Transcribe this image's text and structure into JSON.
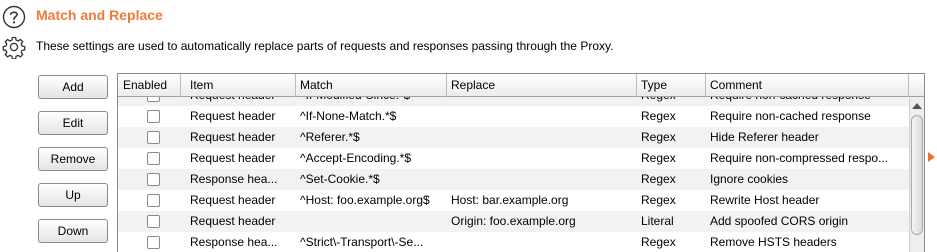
{
  "header": {
    "title": "Match and Replace",
    "description": "These settings are used to automatically replace parts of requests and responses passing through the Proxy."
  },
  "buttons": {
    "add": "Add",
    "edit": "Edit",
    "remove": "Remove",
    "up": "Up",
    "down": "Down"
  },
  "table": {
    "columns": [
      "Enabled",
      "Item",
      "Match",
      "Replace",
      "Type",
      "Comment"
    ],
    "rows": [
      {
        "enabled": false,
        "item": "Request header",
        "match": "^If-Modified-Since.*$",
        "replace": "",
        "type": "Regex",
        "comment": "Require non-cached response"
      },
      {
        "enabled": false,
        "item": "Request header",
        "match": "^If-None-Match.*$",
        "replace": "",
        "type": "Regex",
        "comment": "Require non-cached response"
      },
      {
        "enabled": false,
        "item": "Request header",
        "match": "^Referer.*$",
        "replace": "",
        "type": "Regex",
        "comment": "Hide Referer header"
      },
      {
        "enabled": false,
        "item": "Request header",
        "match": "^Accept-Encoding.*$",
        "replace": "",
        "type": "Regex",
        "comment": "Require non-compressed respo..."
      },
      {
        "enabled": false,
        "item": "Response hea...",
        "match": "^Set-Cookie.*$",
        "replace": "",
        "type": "Regex",
        "comment": "Ignore cookies"
      },
      {
        "enabled": false,
        "item": "Request header",
        "match": "^Host: foo.example.org$",
        "replace": "Host: bar.example.org",
        "type": "Regex",
        "comment": "Rewrite Host header"
      },
      {
        "enabled": false,
        "item": "Request header",
        "match": "",
        "replace": "Origin: foo.example.org",
        "type": "Literal",
        "comment": "Add spoofed CORS origin"
      },
      {
        "enabled": false,
        "item": "Response hea...",
        "match": "^Strict\\-Transport\\-Se...",
        "replace": "",
        "type": "Regex",
        "comment": "Remove HSTS headers"
      }
    ]
  },
  "colors": {
    "title": "#ee7b3a",
    "row_alt": "#f2f2f2",
    "accent_arrow": "#e8742c"
  },
  "icons": {
    "help": "help-icon",
    "settings": "gear-icon",
    "expand": "expand-arrow-icon"
  }
}
